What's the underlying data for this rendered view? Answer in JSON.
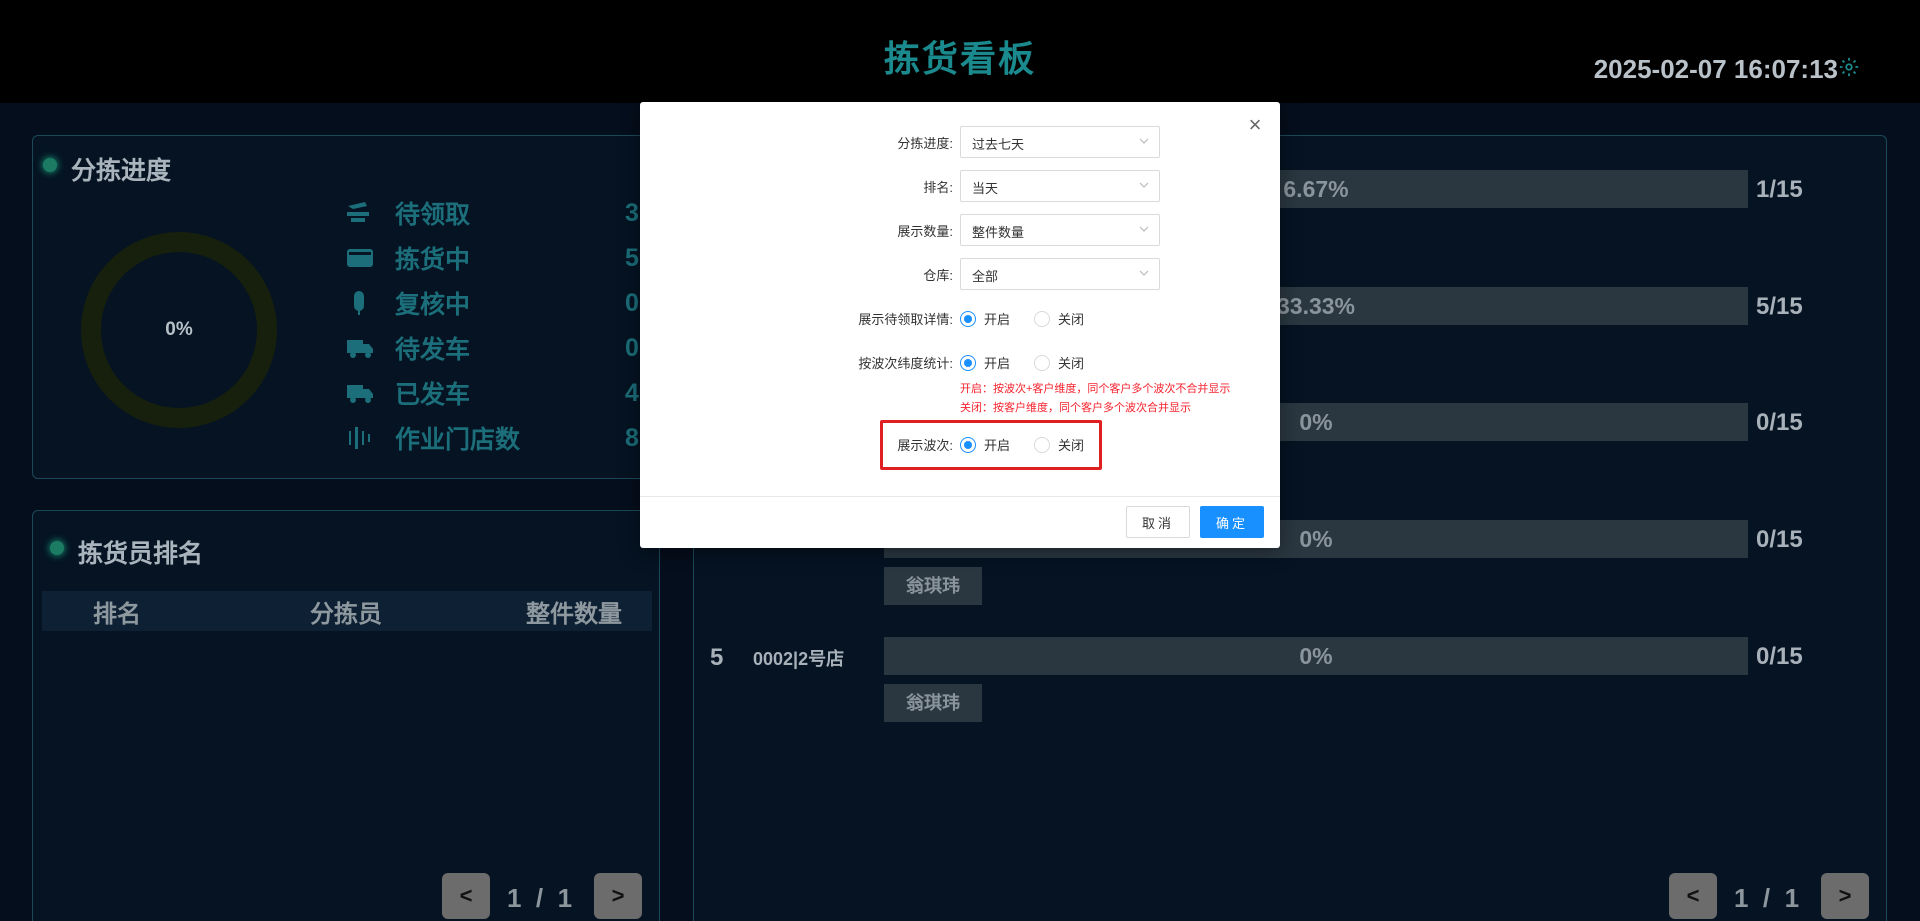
{
  "header": {
    "title": "拣货看板",
    "clock": "2025-02-07 16:07:13",
    "settings_icon": "gear-icon"
  },
  "progress_panel": {
    "title": "分拣进度",
    "donut_percent": "0%",
    "stats": [
      {
        "icon": "hand-icon",
        "label": "待领取",
        "value": "3"
      },
      {
        "icon": "card-icon",
        "label": "拣货中",
        "value": "5"
      },
      {
        "icon": "clip-icon",
        "label": "复核中",
        "value": "0"
      },
      {
        "icon": "truck-icon",
        "label": "待发车",
        "value": "0"
      },
      {
        "icon": "truck-icon",
        "label": "已发车",
        "value": "4"
      },
      {
        "icon": "bars-icon",
        "label": "作业门店数",
        "value": "8"
      }
    ]
  },
  "rank_panel": {
    "title": "拣货员排名",
    "columns": [
      "排名",
      "分拣员",
      "整件数量"
    ],
    "pager": {
      "prev": "<",
      "page_text": "1  /  1",
      "next": ">"
    }
  },
  "right_panel": {
    "rows": [
      {
        "rank": "",
        "store": "",
        "percent": "6.67%",
        "fraction": "1/15",
        "tag": ""
      },
      {
        "rank": "",
        "store": "",
        "percent": "33.33%",
        "fraction": "5/15",
        "tag": ""
      },
      {
        "rank": "",
        "store": "",
        "percent": "0%",
        "fraction": "0/15",
        "tag": ""
      },
      {
        "rank": "",
        "store": "",
        "percent": "0%",
        "fraction": "0/15",
        "tag": "翁琪玮"
      },
      {
        "rank": "5",
        "store": "0002|2号店",
        "percent": "0%",
        "fraction": "0/15",
        "tag": "翁琪玮"
      }
    ],
    "pager": {
      "prev": "<",
      "page_text": "1  /  1",
      "next": ">"
    }
  },
  "modal": {
    "close": "×",
    "fields": {
      "progress": {
        "label": "分拣进度:",
        "value": "过去七天"
      },
      "rank": {
        "label": "排名:",
        "value": "当天"
      },
      "quantity": {
        "label": "展示数量:",
        "value": "整件数量"
      },
      "warehouse": {
        "label": "仓库:",
        "value": "全部"
      },
      "pending_detail": {
        "label": "展示待领取详情:",
        "on": "开启",
        "off": "关闭"
      },
      "wave_stat": {
        "label": "按波次纬度统计:",
        "on": "开启",
        "off": "关闭"
      },
      "hint_on": "开启：按波次+客户维度，同个客户多个波次不合并显示",
      "hint_off": "关闭：按客户维度，同个客户多个波次合并显示",
      "show_wave": {
        "label": "展示波次:",
        "on": "开启",
        "off": "关闭"
      }
    },
    "cancel_label": "取消",
    "ok_label": "确定"
  },
  "colors": {
    "accent": "#1b8a8e",
    "primary": "#1890ff",
    "highlight": "#e02020"
  }
}
